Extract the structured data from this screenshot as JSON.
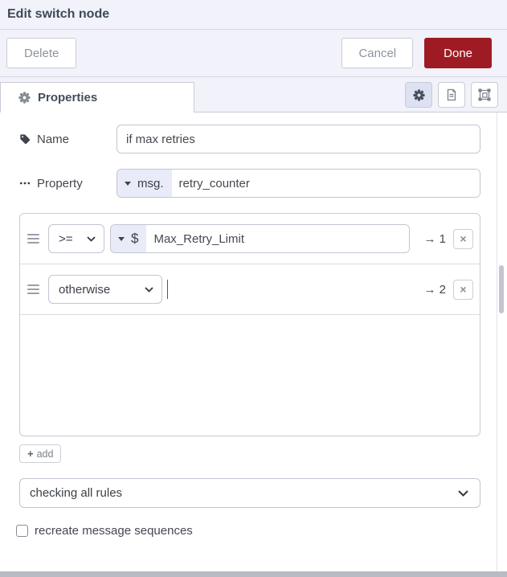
{
  "dialog": {
    "title": "Edit switch node",
    "delete_label": "Delete",
    "cancel_label": "Cancel",
    "done_label": "Done"
  },
  "tabs": {
    "properties_label": "Properties"
  },
  "form": {
    "name": {
      "label": "Name",
      "value": "if max retries"
    },
    "property": {
      "label": "Property",
      "prefix": "msg.",
      "value": "retry_counter"
    }
  },
  "rules": [
    {
      "operator": ">=",
      "value_prefix": "$",
      "value": "Max_Retry_Limit",
      "output": "→ 1",
      "remove_icon": "×"
    },
    {
      "operator": "otherwise",
      "output": "→ 2",
      "remove_icon": "×"
    }
  ],
  "footer": {
    "add_plus_icon": "+",
    "add_label": "add",
    "mode_value": "checking all rules",
    "checkbox_label": "recreate message sequences"
  },
  "colors": {
    "done_red": "#9e1b24",
    "header_bg": "#f1f2fa",
    "selected_tab_button_bg": "#dee1f2"
  }
}
